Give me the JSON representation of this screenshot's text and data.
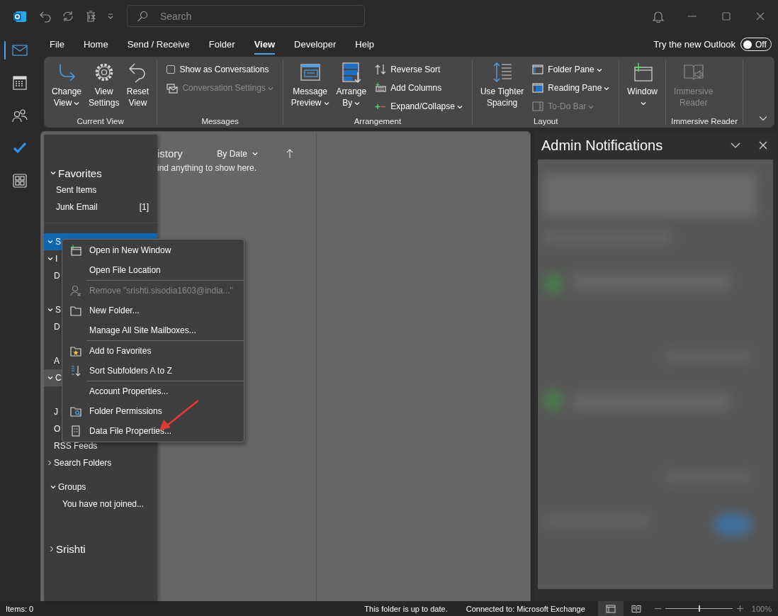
{
  "title_bar": {
    "search_placeholder": "Search"
  },
  "rail": [
    {
      "selected": true
    },
    {
      "selected": false
    },
    {
      "selected": false
    },
    {
      "selected": false
    },
    {
      "selected": false
    }
  ],
  "menu_tabs": [
    {
      "label": "File",
      "selected": false
    },
    {
      "label": "Home",
      "selected": false
    },
    {
      "label": "Send / Receive",
      "selected": false
    },
    {
      "label": "Folder",
      "selected": false
    },
    {
      "label": "View",
      "selected": true
    },
    {
      "label": "Developer",
      "selected": false
    },
    {
      "label": "Help",
      "selected": false
    }
  ],
  "new_outlook": {
    "label": "Try the new Outlook",
    "toggle_label": "Off",
    "on": false
  },
  "ribbon_groups": [
    {
      "label": "Current View",
      "items": [
        {
          "kind": "large",
          "lines": [
            "Change",
            "View"
          ],
          "dropdown": true,
          "disabled": false
        },
        {
          "kind": "large",
          "lines": [
            "View",
            "Settings"
          ],
          "dropdown": false,
          "disabled": false
        },
        {
          "kind": "large",
          "lines": [
            "Reset",
            "View"
          ],
          "dropdown": false,
          "disabled": false
        }
      ]
    },
    {
      "label": "Messages",
      "items": [
        {
          "kind": "checkbox",
          "label": "Show as Conversations",
          "checked": false
        },
        {
          "kind": "small",
          "label": "Conversation Settings",
          "dropdown": true,
          "disabled": true
        }
      ]
    },
    {
      "label": "Arrangement",
      "items": [
        {
          "kind": "large",
          "lines": [
            "Message",
            "Preview"
          ],
          "dropdown": true,
          "disabled": false
        },
        {
          "kind": "large",
          "lines": [
            "Arrange",
            "By"
          ],
          "dropdown": true,
          "disabled": false
        },
        {
          "kind": "small",
          "label": "Reverse Sort",
          "dropdown": false,
          "disabled": false
        },
        {
          "kind": "small",
          "label": "Add Columns",
          "dropdown": false,
          "disabled": false
        },
        {
          "kind": "small",
          "label": "Expand/Collapse",
          "dropdown": true,
          "disabled": false
        }
      ]
    },
    {
      "label": "Layout",
      "items": [
        {
          "kind": "large",
          "lines": [
            "Use Tighter",
            "Spacing"
          ],
          "dropdown": false,
          "disabled": false
        },
        {
          "kind": "small",
          "label": "Folder Pane",
          "dropdown": true,
          "disabled": false
        },
        {
          "kind": "small",
          "label": "Reading Pane",
          "dropdown": true,
          "disabled": false
        },
        {
          "kind": "small",
          "label": "To-Do Bar",
          "dropdown": true,
          "disabled": true
        }
      ]
    },
    {
      "items": [
        {
          "kind": "large",
          "lines": [
            "Window"
          ],
          "dropdown": true,
          "disabled": false
        }
      ]
    },
    {
      "label": "Immersive Reader",
      "items": [
        {
          "kind": "large",
          "lines": [
            "Immersive",
            "Reader"
          ],
          "dropdown": false,
          "disabled": true
        }
      ]
    }
  ],
  "folder_pane": {
    "favorites": {
      "label": "Favorites",
      "expanded": true,
      "items": [
        {
          "label": "Sent Items"
        },
        {
          "label": "Junk Email",
          "count": "[1]"
        }
      ]
    },
    "rows": [
      {
        "kind": "node",
        "label": "S",
        "expanded": true,
        "selected": true,
        "hovered": false
      },
      {
        "kind": "node",
        "label": "I",
        "expanded": true,
        "selected": false,
        "hovered": false
      },
      {
        "kind": "leaf",
        "label": "D",
        "selected": false,
        "hovered": false
      },
      {
        "kind": "node",
        "label": "S",
        "expanded": true,
        "selected": false,
        "hovered": false
      },
      {
        "kind": "leaf",
        "label": "D",
        "selected": false,
        "hovered": false
      },
      {
        "kind": "leaf",
        "label": "A",
        "selected": false,
        "hovered": false
      },
      {
        "kind": "node",
        "label": "C",
        "expanded": true,
        "selected": false,
        "hovered": true
      },
      {
        "kind": "leaf",
        "label": "J",
        "selected": false,
        "hovered": false
      },
      {
        "kind": "leaf",
        "label": "O",
        "selected": false,
        "hovered": false
      },
      {
        "kind": "leaf",
        "label": "RSS Feeds",
        "selected": false,
        "hovered": false
      },
      {
        "kind": "node",
        "label": "Search Folders",
        "expanded": false,
        "selected": false,
        "hovered": false
      }
    ],
    "groups": {
      "label": "Groups",
      "expanded": true,
      "note": "You have not joined..."
    },
    "account": {
      "label": "Srishti",
      "expanded": false
    }
  },
  "message_list": {
    "title": "istory",
    "sort": "By Date",
    "empty_text": "ind anything to show here."
  },
  "admin_panel": {
    "title": "Admin Notifications"
  },
  "context_menu": {
    "sections": [
      [
        {
          "label": "Open in New Window",
          "disabled": false
        },
        {
          "label": "Open File Location",
          "disabled": false
        }
      ],
      [
        {
          "label": "Remove \"srishti.sisodia1603@india...\"",
          "disabled": true
        },
        {
          "label": "New Folder...",
          "disabled": false
        },
        {
          "label": "Manage All Site Mailboxes...",
          "disabled": false
        }
      ],
      [
        {
          "label": "Add to Favorites",
          "disabled": false
        },
        {
          "label": "Sort Subfolders A to Z",
          "disabled": false
        }
      ],
      [
        {
          "label": "Account Properties...",
          "disabled": false
        },
        {
          "label": "Folder Permissions",
          "disabled": false
        },
        {
          "label": "Data File Properties...",
          "disabled": false
        }
      ]
    ]
  },
  "status_bar": {
    "items": "Items: 0",
    "sync": "This folder is up to date.",
    "connection": "Connected to: Microsoft Exchange",
    "view_buttons": [
      {
        "selected": true
      },
      {
        "selected": false
      }
    ],
    "zoom": {
      "level": 0.5,
      "reading": "100%"
    }
  }
}
